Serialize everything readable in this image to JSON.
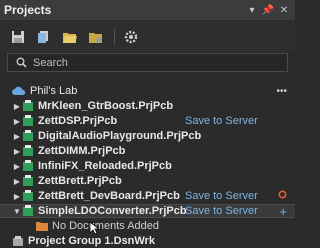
{
  "panel": {
    "title": "Projects"
  },
  "search": {
    "placeholder": "Search"
  },
  "workspace": {
    "label": "Phil's Lab"
  },
  "projects": [
    {
      "name": "MrKleen_GtrBoost.PrjPcb",
      "save_label": ""
    },
    {
      "name": "ZettDSP.PrjPcb",
      "save_label": "Save to Server"
    },
    {
      "name": "DigitalAudioPlayground.PrjPcb",
      "save_label": ""
    },
    {
      "name": "ZettDIMM.PrjPcb",
      "save_label": ""
    },
    {
      "name": "InfiniFX_Reloaded.PrjPcb",
      "save_label": ""
    },
    {
      "name": "ZettBrett.PrjPcb",
      "save_label": ""
    },
    {
      "name": "ZettBrett_DevBoard.PrjPcb",
      "save_label": "Save to Server"
    },
    {
      "name": "SimpleLDOConverter.PrjPcb",
      "save_label": "Save to Server"
    }
  ],
  "no_docs": "No Documents Added",
  "project_group": "Project Group 1.DsnWrk",
  "colors": {
    "accent_blue": "#79b4e8",
    "red_status": "#e0603a",
    "folder": "#d9883b"
  }
}
